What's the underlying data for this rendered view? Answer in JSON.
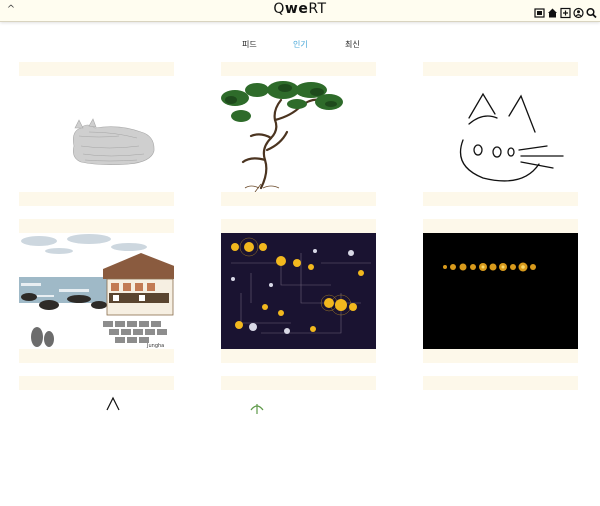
{
  "header": {
    "logo_part1": "Q",
    "logo_part2": "we",
    "logo_part3": "RT",
    "collapse_glyph": "^",
    "icons": [
      "gallery-icon",
      "home-icon",
      "add-post-icon",
      "profile-icon",
      "search-icon"
    ]
  },
  "tabs": [
    {
      "label": "피드",
      "active": false
    },
    {
      "label": "인기",
      "active": true
    },
    {
      "label": "최신",
      "active": false
    }
  ],
  "colors": {
    "topbar": "#fffdf0",
    "card_band": "#fdf8ea",
    "active_tab": "#4aa8d8"
  },
  "posts": [
    {
      "subject": "sleeping-cat-sketch"
    },
    {
      "subject": "pine-tree-painting"
    },
    {
      "subject": "cat-line-drawing"
    },
    {
      "subject": "seaside-house-painting",
      "signature": "Jungha"
    },
    {
      "subject": "glowing-lights-network"
    },
    {
      "subject": "glowing-lights-line"
    },
    {
      "subject": "partial-line-drawing"
    },
    {
      "subject": "partial-plant-drawing"
    },
    {
      "subject": "partial-blank"
    }
  ]
}
